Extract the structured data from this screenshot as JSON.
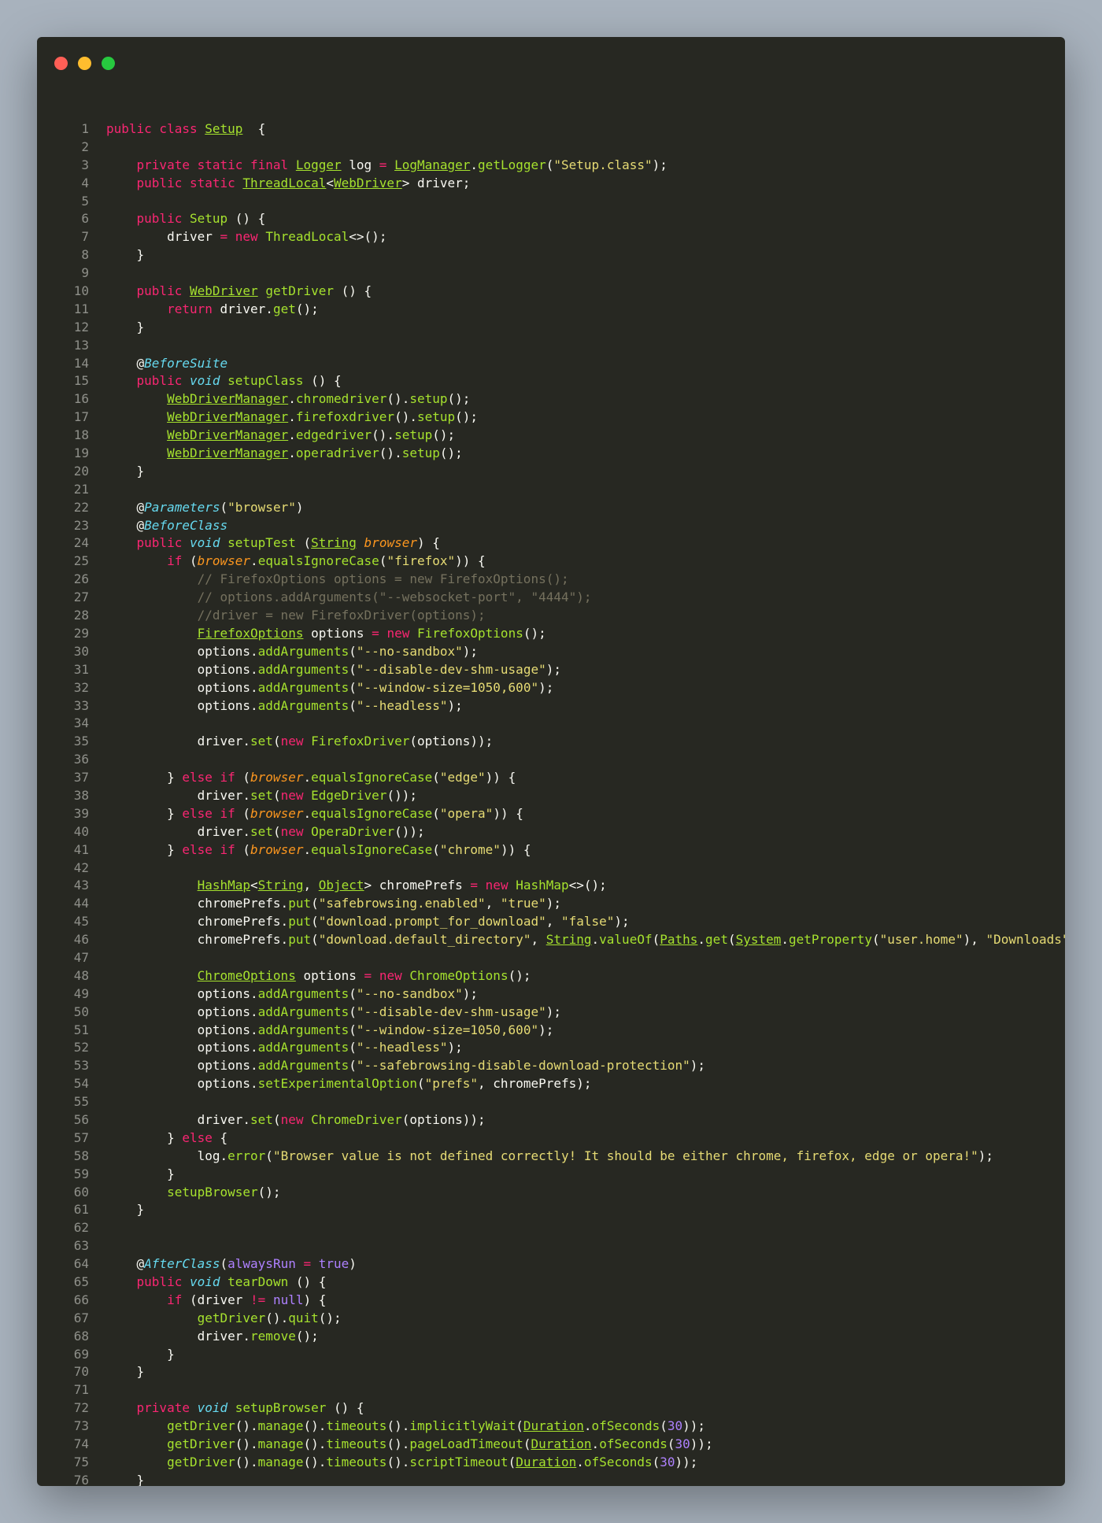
{
  "window": {
    "dots": [
      {
        "name": "close",
        "color": "#ff5f56"
      },
      {
        "name": "minimize",
        "color": "#ffbd2e"
      },
      {
        "name": "maximize",
        "color": "#27c93f"
      }
    ]
  },
  "code_lines": [
    [
      [
        "k",
        "public class "
      ],
      [
        "tu",
        "Setup"
      ],
      [
        "",
        "  {"
      ]
    ],
    [],
    [
      [
        "",
        "    "
      ],
      [
        "k",
        "private static final "
      ],
      [
        "tu",
        "Logger"
      ],
      [
        "",
        " log "
      ],
      [
        "k",
        "="
      ],
      [
        "",
        " "
      ],
      [
        "tu",
        "LogManager"
      ],
      [
        "",
        "."
      ],
      [
        "f",
        "getLogger"
      ],
      [
        "",
        "("
      ],
      [
        "s",
        "\"Setup.class\""
      ],
      [
        "",
        ");"
      ]
    ],
    [
      [
        "",
        "    "
      ],
      [
        "k",
        "public static "
      ],
      [
        "tu",
        "ThreadLocal"
      ],
      [
        "",
        "<"
      ],
      [
        "tu",
        "WebDriver"
      ],
      [
        "",
        "> driver;"
      ]
    ],
    [],
    [
      [
        "",
        "    "
      ],
      [
        "k",
        "public "
      ],
      [
        "t",
        "Setup"
      ],
      [
        "",
        " () {"
      ]
    ],
    [
      [
        "",
        "        driver "
      ],
      [
        "k",
        "="
      ],
      [
        "",
        " "
      ],
      [
        "k",
        "new "
      ],
      [
        "t",
        "ThreadLocal"
      ],
      [
        "",
        "<>();"
      ]
    ],
    [
      [
        "",
        "    }"
      ]
    ],
    [],
    [
      [
        "",
        "    "
      ],
      [
        "k",
        "public "
      ],
      [
        "tu",
        "WebDriver"
      ],
      [
        "",
        " "
      ],
      [
        "f",
        "getDriver"
      ],
      [
        "",
        " () {"
      ]
    ],
    [
      [
        "",
        "        "
      ],
      [
        "k",
        "return "
      ],
      [
        "",
        "driver."
      ],
      [
        "f",
        "get"
      ],
      [
        "",
        "();"
      ]
    ],
    [
      [
        "",
        "    }"
      ]
    ],
    [],
    [
      [
        "",
        "    @"
      ],
      [
        "a",
        "BeforeSuite"
      ]
    ],
    [
      [
        "",
        "    "
      ],
      [
        "k",
        "public "
      ],
      [
        "ki",
        "void "
      ],
      [
        "f",
        "setupClass"
      ],
      [
        "",
        " () {"
      ]
    ],
    [
      [
        "",
        "        "
      ],
      [
        "tu",
        "WebDriverManager"
      ],
      [
        "",
        "."
      ],
      [
        "f",
        "chromedriver"
      ],
      [
        "",
        "()."
      ],
      [
        "f",
        "setup"
      ],
      [
        "",
        "();"
      ]
    ],
    [
      [
        "",
        "        "
      ],
      [
        "tu",
        "WebDriverManager"
      ],
      [
        "",
        "."
      ],
      [
        "f",
        "firefoxdriver"
      ],
      [
        "",
        "()."
      ],
      [
        "f",
        "setup"
      ],
      [
        "",
        "();"
      ]
    ],
    [
      [
        "",
        "        "
      ],
      [
        "tu",
        "WebDriverManager"
      ],
      [
        "",
        "."
      ],
      [
        "f",
        "edgedriver"
      ],
      [
        "",
        "()."
      ],
      [
        "f",
        "setup"
      ],
      [
        "",
        "();"
      ]
    ],
    [
      [
        "",
        "        "
      ],
      [
        "tu",
        "WebDriverManager"
      ],
      [
        "",
        "."
      ],
      [
        "f",
        "operadriver"
      ],
      [
        "",
        "()."
      ],
      [
        "f",
        "setup"
      ],
      [
        "",
        "();"
      ]
    ],
    [
      [
        "",
        "    }"
      ]
    ],
    [],
    [
      [
        "",
        "    @"
      ],
      [
        "a",
        "Parameters"
      ],
      [
        "",
        "("
      ],
      [
        "s",
        "\"browser\""
      ],
      [
        "",
        ")"
      ]
    ],
    [
      [
        "",
        "    @"
      ],
      [
        "a",
        "BeforeClass"
      ]
    ],
    [
      [
        "",
        "    "
      ],
      [
        "k",
        "public "
      ],
      [
        "ki",
        "void "
      ],
      [
        "f",
        "setupTest"
      ],
      [
        "",
        " ("
      ],
      [
        "tu",
        "String"
      ],
      [
        "",
        " "
      ],
      [
        "pa",
        "browser"
      ],
      [
        "",
        ") {"
      ]
    ],
    [
      [
        "",
        "        "
      ],
      [
        "k",
        "if "
      ],
      [
        "",
        "("
      ],
      [
        "pa",
        "browser"
      ],
      [
        "",
        "."
      ],
      [
        "f",
        "equalsIgnoreCase"
      ],
      [
        "",
        "("
      ],
      [
        "s",
        "\"firefox\""
      ],
      [
        "",
        ")) {"
      ]
    ],
    [
      [
        "",
        "            "
      ],
      [
        "c",
        "// FirefoxOptions options = new FirefoxOptions();"
      ]
    ],
    [
      [
        "",
        "            "
      ],
      [
        "c",
        "// options.addArguments(\"--websocket-port\", \"4444\");"
      ]
    ],
    [
      [
        "",
        "            "
      ],
      [
        "c",
        "//driver = new FirefoxDriver(options);"
      ]
    ],
    [
      [
        "",
        "            "
      ],
      [
        "tu",
        "FirefoxOptions"
      ],
      [
        "",
        " options "
      ],
      [
        "k",
        "="
      ],
      [
        "",
        " "
      ],
      [
        "k",
        "new "
      ],
      [
        "t",
        "FirefoxOptions"
      ],
      [
        "",
        "();"
      ]
    ],
    [
      [
        "",
        "            options."
      ],
      [
        "f",
        "addArguments"
      ],
      [
        "",
        "("
      ],
      [
        "s",
        "\"--no-sandbox\""
      ],
      [
        "",
        ");"
      ]
    ],
    [
      [
        "",
        "            options."
      ],
      [
        "f",
        "addArguments"
      ],
      [
        "",
        "("
      ],
      [
        "s",
        "\"--disable-dev-shm-usage\""
      ],
      [
        "",
        ");"
      ]
    ],
    [
      [
        "",
        "            options."
      ],
      [
        "f",
        "addArguments"
      ],
      [
        "",
        "("
      ],
      [
        "s",
        "\"--window-size=1050,600\""
      ],
      [
        "",
        ");"
      ]
    ],
    [
      [
        "",
        "            options."
      ],
      [
        "f",
        "addArguments"
      ],
      [
        "",
        "("
      ],
      [
        "s",
        "\"--headless\""
      ],
      [
        "",
        ");"
      ]
    ],
    [],
    [
      [
        "",
        "            driver."
      ],
      [
        "f",
        "set"
      ],
      [
        "",
        "("
      ],
      [
        "k",
        "new "
      ],
      [
        "t",
        "FirefoxDriver"
      ],
      [
        "",
        "(options));"
      ]
    ],
    [],
    [
      [
        "",
        "        } "
      ],
      [
        "k",
        "else if "
      ],
      [
        "",
        "("
      ],
      [
        "pa",
        "browser"
      ],
      [
        "",
        "."
      ],
      [
        "f",
        "equalsIgnoreCase"
      ],
      [
        "",
        "("
      ],
      [
        "s",
        "\"edge\""
      ],
      [
        "",
        ")) {"
      ]
    ],
    [
      [
        "",
        "            driver."
      ],
      [
        "f",
        "set"
      ],
      [
        "",
        "("
      ],
      [
        "k",
        "new "
      ],
      [
        "t",
        "EdgeDriver"
      ],
      [
        "",
        "());"
      ]
    ],
    [
      [
        "",
        "        } "
      ],
      [
        "k",
        "else if "
      ],
      [
        "",
        "("
      ],
      [
        "pa",
        "browser"
      ],
      [
        "",
        "."
      ],
      [
        "f",
        "equalsIgnoreCase"
      ],
      [
        "",
        "("
      ],
      [
        "s",
        "\"opera\""
      ],
      [
        "",
        ")) {"
      ]
    ],
    [
      [
        "",
        "            driver."
      ],
      [
        "f",
        "set"
      ],
      [
        "",
        "("
      ],
      [
        "k",
        "new "
      ],
      [
        "t",
        "OperaDriver"
      ],
      [
        "",
        "());"
      ]
    ],
    [
      [
        "",
        "        } "
      ],
      [
        "k",
        "else if "
      ],
      [
        "",
        "("
      ],
      [
        "pa",
        "browser"
      ],
      [
        "",
        "."
      ],
      [
        "f",
        "equalsIgnoreCase"
      ],
      [
        "",
        "("
      ],
      [
        "s",
        "\"chrome\""
      ],
      [
        "",
        ")) {"
      ]
    ],
    [],
    [
      [
        "",
        "            "
      ],
      [
        "tu",
        "HashMap"
      ],
      [
        "",
        "<"
      ],
      [
        "tu",
        "String"
      ],
      [
        "",
        ", "
      ],
      [
        "tu",
        "Object"
      ],
      [
        "",
        "> chromePrefs "
      ],
      [
        "k",
        "="
      ],
      [
        "",
        " "
      ],
      [
        "k",
        "new "
      ],
      [
        "t",
        "HashMap"
      ],
      [
        "",
        "<>();"
      ]
    ],
    [
      [
        "",
        "            chromePrefs."
      ],
      [
        "f",
        "put"
      ],
      [
        "",
        "("
      ],
      [
        "s",
        "\"safebrowsing.enabled\""
      ],
      [
        "",
        ", "
      ],
      [
        "s",
        "\"true\""
      ],
      [
        "",
        ");"
      ]
    ],
    [
      [
        "",
        "            chromePrefs."
      ],
      [
        "f",
        "put"
      ],
      [
        "",
        "("
      ],
      [
        "s",
        "\"download.prompt_for_download\""
      ],
      [
        "",
        ", "
      ],
      [
        "s",
        "\"false\""
      ],
      [
        "",
        ");"
      ]
    ],
    [
      [
        "",
        "            chromePrefs."
      ],
      [
        "f",
        "put"
      ],
      [
        "",
        "("
      ],
      [
        "s",
        "\"download.default_directory\""
      ],
      [
        "",
        ", "
      ],
      [
        "tu",
        "String"
      ],
      [
        "",
        "."
      ],
      [
        "f",
        "valueOf"
      ],
      [
        "",
        "("
      ],
      [
        "tu",
        "Paths"
      ],
      [
        "",
        "."
      ],
      [
        "f",
        "get"
      ],
      [
        "",
        "("
      ],
      [
        "tu",
        "System"
      ],
      [
        "",
        "."
      ],
      [
        "f",
        "getProperty"
      ],
      [
        "",
        "("
      ],
      [
        "s",
        "\"user.home\""
      ],
      [
        "",
        "), "
      ],
      [
        "s",
        "\"Downloads\""
      ],
      [
        "",
        ")));"
      ]
    ],
    [],
    [
      [
        "",
        "            "
      ],
      [
        "tu",
        "ChromeOptions"
      ],
      [
        "",
        " options "
      ],
      [
        "k",
        "="
      ],
      [
        "",
        " "
      ],
      [
        "k",
        "new "
      ],
      [
        "t",
        "ChromeOptions"
      ],
      [
        "",
        "();"
      ]
    ],
    [
      [
        "",
        "            options."
      ],
      [
        "f",
        "addArguments"
      ],
      [
        "",
        "("
      ],
      [
        "s",
        "\"--no-sandbox\""
      ],
      [
        "",
        ");"
      ]
    ],
    [
      [
        "",
        "            options."
      ],
      [
        "f",
        "addArguments"
      ],
      [
        "",
        "("
      ],
      [
        "s",
        "\"--disable-dev-shm-usage\""
      ],
      [
        "",
        ");"
      ]
    ],
    [
      [
        "",
        "            options."
      ],
      [
        "f",
        "addArguments"
      ],
      [
        "",
        "("
      ],
      [
        "s",
        "\"--window-size=1050,600\""
      ],
      [
        "",
        ");"
      ]
    ],
    [
      [
        "",
        "            options."
      ],
      [
        "f",
        "addArguments"
      ],
      [
        "",
        "("
      ],
      [
        "s",
        "\"--headless\""
      ],
      [
        "",
        ");"
      ]
    ],
    [
      [
        "",
        "            options."
      ],
      [
        "f",
        "addArguments"
      ],
      [
        "",
        "("
      ],
      [
        "s",
        "\"--safebrowsing-disable-download-protection\""
      ],
      [
        "",
        ");"
      ]
    ],
    [
      [
        "",
        "            options."
      ],
      [
        "f",
        "setExperimentalOption"
      ],
      [
        "",
        "("
      ],
      [
        "s",
        "\"prefs\""
      ],
      [
        "",
        ", chromePrefs);"
      ]
    ],
    [],
    [
      [
        "",
        "            driver."
      ],
      [
        "f",
        "set"
      ],
      [
        "",
        "("
      ],
      [
        "k",
        "new "
      ],
      [
        "t",
        "ChromeDriver"
      ],
      [
        "",
        "(options));"
      ]
    ],
    [
      [
        "",
        "        } "
      ],
      [
        "k",
        "else "
      ],
      [
        "",
        "{"
      ]
    ],
    [
      [
        "",
        "            log."
      ],
      [
        "f",
        "error"
      ],
      [
        "",
        "("
      ],
      [
        "s",
        "\"Browser value is not defined correctly! It should be either chrome, firefox, edge or opera!\""
      ],
      [
        "",
        ");"
      ]
    ],
    [
      [
        "",
        "        }"
      ]
    ],
    [
      [
        "",
        "        "
      ],
      [
        "f",
        "setupBrowser"
      ],
      [
        "",
        "();"
      ]
    ],
    [
      [
        "",
        "    }"
      ]
    ],
    [],
    [],
    [
      [
        "",
        "    @"
      ],
      [
        "a",
        "AfterClass"
      ],
      [
        "",
        "("
      ],
      [
        "n",
        "alwaysRun"
      ],
      [
        "",
        " "
      ],
      [
        "k",
        "="
      ],
      [
        "",
        " "
      ],
      [
        "n",
        "true"
      ],
      [
        "",
        ")"
      ]
    ],
    [
      [
        "",
        "    "
      ],
      [
        "k",
        "public "
      ],
      [
        "ki",
        "void "
      ],
      [
        "f",
        "tearDown"
      ],
      [
        "",
        " () {"
      ]
    ],
    [
      [
        "",
        "        "
      ],
      [
        "k",
        "if "
      ],
      [
        "",
        "(driver "
      ],
      [
        "k",
        "!="
      ],
      [
        "",
        " "
      ],
      [
        "n",
        "null"
      ],
      [
        "",
        ") {"
      ]
    ],
    [
      [
        "",
        "            "
      ],
      [
        "f",
        "getDriver"
      ],
      [
        "",
        "()."
      ],
      [
        "f",
        "quit"
      ],
      [
        "",
        "();"
      ]
    ],
    [
      [
        "",
        "            driver."
      ],
      [
        "f",
        "remove"
      ],
      [
        "",
        "();"
      ]
    ],
    [
      [
        "",
        "        }"
      ]
    ],
    [
      [
        "",
        "    }"
      ]
    ],
    [],
    [
      [
        "",
        "    "
      ],
      [
        "k",
        "private "
      ],
      [
        "ki",
        "void "
      ],
      [
        "f",
        "setupBrowser"
      ],
      [
        "",
        " () {"
      ]
    ],
    [
      [
        "",
        "        "
      ],
      [
        "f",
        "getDriver"
      ],
      [
        "",
        "()."
      ],
      [
        "f",
        "manage"
      ],
      [
        "",
        "()."
      ],
      [
        "f",
        "timeouts"
      ],
      [
        "",
        "()."
      ],
      [
        "f",
        "implicitlyWait"
      ],
      [
        "",
        "("
      ],
      [
        "tu",
        "Duration"
      ],
      [
        "",
        "."
      ],
      [
        "f",
        "ofSeconds"
      ],
      [
        "",
        "("
      ],
      [
        "n",
        "30"
      ],
      [
        "",
        "));"
      ]
    ],
    [
      [
        "",
        "        "
      ],
      [
        "f",
        "getDriver"
      ],
      [
        "",
        "()."
      ],
      [
        "f",
        "manage"
      ],
      [
        "",
        "()."
      ],
      [
        "f",
        "timeouts"
      ],
      [
        "",
        "()."
      ],
      [
        "f",
        "pageLoadTimeout"
      ],
      [
        "",
        "("
      ],
      [
        "tu",
        "Duration"
      ],
      [
        "",
        "."
      ],
      [
        "f",
        "ofSeconds"
      ],
      [
        "",
        "("
      ],
      [
        "n",
        "30"
      ],
      [
        "",
        "));"
      ]
    ],
    [
      [
        "",
        "        "
      ],
      [
        "f",
        "getDriver"
      ],
      [
        "",
        "()."
      ],
      [
        "f",
        "manage"
      ],
      [
        "",
        "()."
      ],
      [
        "f",
        "timeouts"
      ],
      [
        "",
        "()."
      ],
      [
        "f",
        "scriptTimeout"
      ],
      [
        "",
        "("
      ],
      [
        "tu",
        "Duration"
      ],
      [
        "",
        "."
      ],
      [
        "f",
        "ofSeconds"
      ],
      [
        "",
        "("
      ],
      [
        "n",
        "30"
      ],
      [
        "",
        "));"
      ]
    ],
    [
      [
        "",
        "    }"
      ]
    ],
    [
      [
        "",
        "}"
      ]
    ]
  ]
}
